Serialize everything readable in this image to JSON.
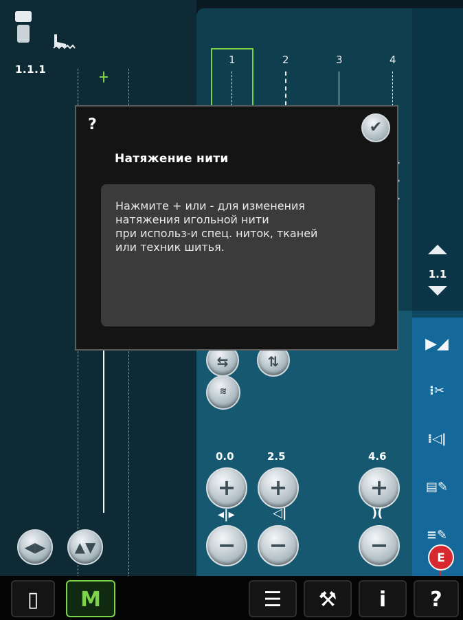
{
  "left_panel": {
    "pattern_number": "1.1.1"
  },
  "stitch_selector": {
    "positions": [
      "1",
      "2",
      "3",
      "4"
    ],
    "selected": "1"
  },
  "params": {
    "stitch_width": "0.0",
    "stitch_length": "2.5",
    "thread_tension": "4.6"
  },
  "right_bar": {
    "page": "1.1"
  },
  "badge": {
    "letter": "E"
  },
  "help_dialog": {
    "icon": "?",
    "confirm_icon": "check-icon",
    "title": "Натяжение нити",
    "body": "Нажмите + или - для изменения\nнатяжения игольной нити\nпри использ-и спец. ниток, тканей\nили техник шитья."
  },
  "colors": {
    "accent_green": "#7cd34a",
    "badge_red": "#d6282e",
    "toolbar_blue": "#14689a"
  }
}
